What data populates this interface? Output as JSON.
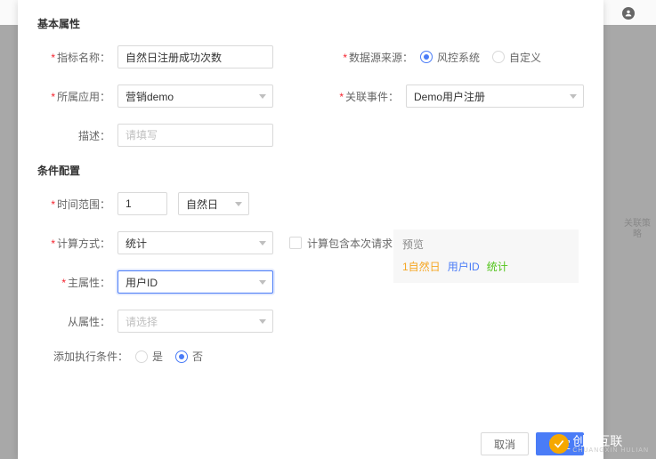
{
  "section1_title": "基本属性",
  "section2_title": "条件配置",
  "labels": {
    "metric_name": "指标名称：",
    "data_source": "数据源来源：",
    "app": "所属应用：",
    "related_event": "关联事件：",
    "desc": "描述：",
    "time_range": "时间范围：",
    "calc_method": "计算方式：",
    "main_attr": "主属性：",
    "sub_attr": "从属性：",
    "add_condition": "添加执行条件："
  },
  "values": {
    "metric_name": "自然日注册成功次数",
    "app": "营销demo",
    "related_event": "Demo用户注册",
    "time_range_num": "1",
    "time_range_unit": "自然日",
    "calc_method": "统计",
    "main_attr": "用户ID"
  },
  "placeholders": {
    "desc": "请填写",
    "sub_attr": "请选择"
  },
  "radio": {
    "source_risk": "风控系统",
    "source_custom": "自定义",
    "cond_yes": "是",
    "cond_no": "否"
  },
  "checkbox": {
    "include_current": "计算包含本次请求"
  },
  "preview": {
    "title": "预览",
    "p1": "1自然日",
    "p2": "用户ID",
    "p3": "统计"
  },
  "buttons": {
    "cancel": "取消",
    "confirm": "确定"
  },
  "side_text": "关联策略",
  "watermark": {
    "main": "创新互联",
    "sub": "CHUANGXIN HULIAN"
  }
}
